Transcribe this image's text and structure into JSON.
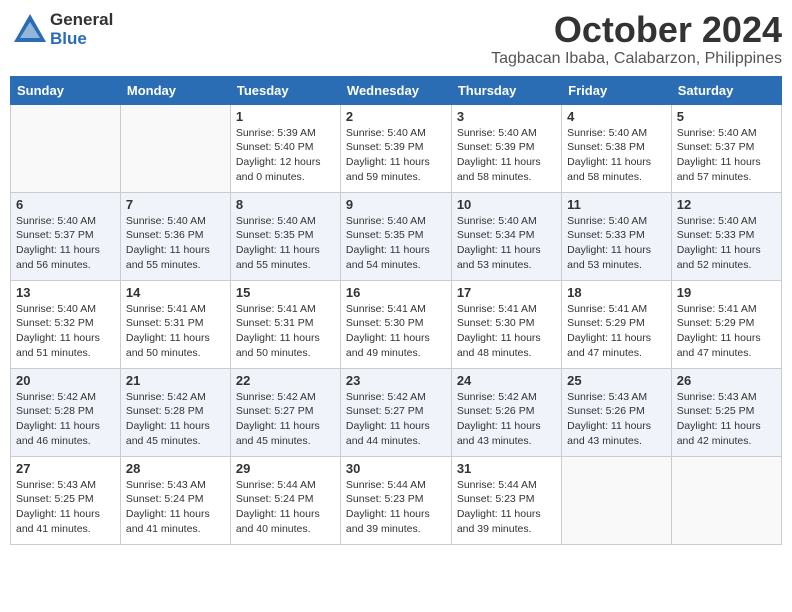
{
  "header": {
    "logo_general": "General",
    "logo_blue": "Blue",
    "month_title": "October 2024",
    "location": "Tagbacan Ibaba, Calabarzon, Philippines"
  },
  "days_of_week": [
    "Sunday",
    "Monday",
    "Tuesday",
    "Wednesday",
    "Thursday",
    "Friday",
    "Saturday"
  ],
  "weeks": [
    [
      {
        "day": "",
        "info": ""
      },
      {
        "day": "",
        "info": ""
      },
      {
        "day": "1",
        "info": "Sunrise: 5:39 AM\nSunset: 5:40 PM\nDaylight: 12 hours\nand 0 minutes."
      },
      {
        "day": "2",
        "info": "Sunrise: 5:40 AM\nSunset: 5:39 PM\nDaylight: 11 hours\nand 59 minutes."
      },
      {
        "day": "3",
        "info": "Sunrise: 5:40 AM\nSunset: 5:39 PM\nDaylight: 11 hours\nand 58 minutes."
      },
      {
        "day": "4",
        "info": "Sunrise: 5:40 AM\nSunset: 5:38 PM\nDaylight: 11 hours\nand 58 minutes."
      },
      {
        "day": "5",
        "info": "Sunrise: 5:40 AM\nSunset: 5:37 PM\nDaylight: 11 hours\nand 57 minutes."
      }
    ],
    [
      {
        "day": "6",
        "info": "Sunrise: 5:40 AM\nSunset: 5:37 PM\nDaylight: 11 hours\nand 56 minutes."
      },
      {
        "day": "7",
        "info": "Sunrise: 5:40 AM\nSunset: 5:36 PM\nDaylight: 11 hours\nand 55 minutes."
      },
      {
        "day": "8",
        "info": "Sunrise: 5:40 AM\nSunset: 5:35 PM\nDaylight: 11 hours\nand 55 minutes."
      },
      {
        "day": "9",
        "info": "Sunrise: 5:40 AM\nSunset: 5:35 PM\nDaylight: 11 hours\nand 54 minutes."
      },
      {
        "day": "10",
        "info": "Sunrise: 5:40 AM\nSunset: 5:34 PM\nDaylight: 11 hours\nand 53 minutes."
      },
      {
        "day": "11",
        "info": "Sunrise: 5:40 AM\nSunset: 5:33 PM\nDaylight: 11 hours\nand 53 minutes."
      },
      {
        "day": "12",
        "info": "Sunrise: 5:40 AM\nSunset: 5:33 PM\nDaylight: 11 hours\nand 52 minutes."
      }
    ],
    [
      {
        "day": "13",
        "info": "Sunrise: 5:40 AM\nSunset: 5:32 PM\nDaylight: 11 hours\nand 51 minutes."
      },
      {
        "day": "14",
        "info": "Sunrise: 5:41 AM\nSunset: 5:31 PM\nDaylight: 11 hours\nand 50 minutes."
      },
      {
        "day": "15",
        "info": "Sunrise: 5:41 AM\nSunset: 5:31 PM\nDaylight: 11 hours\nand 50 minutes."
      },
      {
        "day": "16",
        "info": "Sunrise: 5:41 AM\nSunset: 5:30 PM\nDaylight: 11 hours\nand 49 minutes."
      },
      {
        "day": "17",
        "info": "Sunrise: 5:41 AM\nSunset: 5:30 PM\nDaylight: 11 hours\nand 48 minutes."
      },
      {
        "day": "18",
        "info": "Sunrise: 5:41 AM\nSunset: 5:29 PM\nDaylight: 11 hours\nand 47 minutes."
      },
      {
        "day": "19",
        "info": "Sunrise: 5:41 AM\nSunset: 5:29 PM\nDaylight: 11 hours\nand 47 minutes."
      }
    ],
    [
      {
        "day": "20",
        "info": "Sunrise: 5:42 AM\nSunset: 5:28 PM\nDaylight: 11 hours\nand 46 minutes."
      },
      {
        "day": "21",
        "info": "Sunrise: 5:42 AM\nSunset: 5:28 PM\nDaylight: 11 hours\nand 45 minutes."
      },
      {
        "day": "22",
        "info": "Sunrise: 5:42 AM\nSunset: 5:27 PM\nDaylight: 11 hours\nand 45 minutes."
      },
      {
        "day": "23",
        "info": "Sunrise: 5:42 AM\nSunset: 5:27 PM\nDaylight: 11 hours\nand 44 minutes."
      },
      {
        "day": "24",
        "info": "Sunrise: 5:42 AM\nSunset: 5:26 PM\nDaylight: 11 hours\nand 43 minutes."
      },
      {
        "day": "25",
        "info": "Sunrise: 5:43 AM\nSunset: 5:26 PM\nDaylight: 11 hours\nand 43 minutes."
      },
      {
        "day": "26",
        "info": "Sunrise: 5:43 AM\nSunset: 5:25 PM\nDaylight: 11 hours\nand 42 minutes."
      }
    ],
    [
      {
        "day": "27",
        "info": "Sunrise: 5:43 AM\nSunset: 5:25 PM\nDaylight: 11 hours\nand 41 minutes."
      },
      {
        "day": "28",
        "info": "Sunrise: 5:43 AM\nSunset: 5:24 PM\nDaylight: 11 hours\nand 41 minutes."
      },
      {
        "day": "29",
        "info": "Sunrise: 5:44 AM\nSunset: 5:24 PM\nDaylight: 11 hours\nand 40 minutes."
      },
      {
        "day": "30",
        "info": "Sunrise: 5:44 AM\nSunset: 5:23 PM\nDaylight: 11 hours\nand 39 minutes."
      },
      {
        "day": "31",
        "info": "Sunrise: 5:44 AM\nSunset: 5:23 PM\nDaylight: 11 hours\nand 39 minutes."
      },
      {
        "day": "",
        "info": ""
      },
      {
        "day": "",
        "info": ""
      }
    ]
  ]
}
